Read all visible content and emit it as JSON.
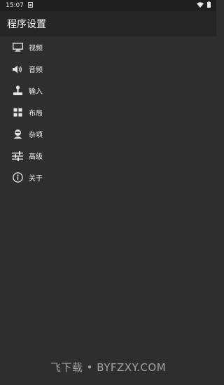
{
  "status_bar": {
    "time": "15:07",
    "notification_icon": "sim-icon",
    "wifi_icon": "wifi-icon",
    "battery_icon": "battery-icon"
  },
  "app_bar": {
    "title": "程序设置"
  },
  "menu": {
    "items": [
      {
        "label": "视频",
        "icon": "monitor-icon"
      },
      {
        "label": "音频",
        "icon": "speaker-icon"
      },
      {
        "label": "输入",
        "icon": "joystick-icon"
      },
      {
        "label": "布局",
        "icon": "grid-icon"
      },
      {
        "label": "杂项",
        "icon": "misc-icon"
      },
      {
        "label": "高级",
        "icon": "sliders-icon"
      },
      {
        "label": "关于",
        "icon": "info-icon"
      }
    ]
  },
  "watermark": {
    "text": "飞下载 • BYFZXY.COM"
  },
  "colors": {
    "background": "#2e2e2e",
    "app_bar": "#262626",
    "status_bar": "#1f1f1f",
    "text": "#ffffff"
  }
}
